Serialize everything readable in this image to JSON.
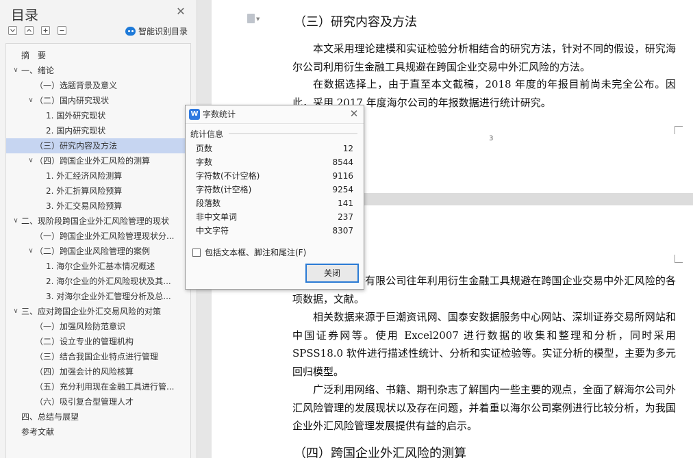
{
  "sidebar": {
    "title": "目录",
    "smart_toc_label": "智能识别目录",
    "toc": [
      {
        "label": "摘　要",
        "level": 0,
        "has_arrow": false,
        "active": false
      },
      {
        "label": "一、绪论",
        "level": 0,
        "has_arrow": true,
        "active": false
      },
      {
        "label": "（一）选题背景及意义",
        "level": 1,
        "has_arrow": false,
        "active": false
      },
      {
        "label": "（二）国内研究现状",
        "level": 1,
        "has_arrow": true,
        "active": false
      },
      {
        "label": "1. 国外研究现状",
        "level": 2,
        "has_arrow": false,
        "active": false
      },
      {
        "label": "2. 国内研究现状",
        "level": 2,
        "has_arrow": false,
        "active": false
      },
      {
        "label": "（三）研究内容及方法",
        "level": 1,
        "has_arrow": false,
        "active": true
      },
      {
        "label": "（四）跨国企业外汇风险的测算",
        "level": 1,
        "has_arrow": true,
        "active": false
      },
      {
        "label": "1. 外汇经济风险测算",
        "level": 2,
        "has_arrow": false,
        "active": false
      },
      {
        "label": "2. 外汇折算风险预算",
        "level": 2,
        "has_arrow": false,
        "active": false
      },
      {
        "label": "3. 外汇交易风险预算",
        "level": 2,
        "has_arrow": false,
        "active": false
      },
      {
        "label": "二、现阶段跨国企业外汇风险管理的现状",
        "level": 0,
        "has_arrow": true,
        "active": false
      },
      {
        "label": "（一）跨国企业外汇风险管理现状分...",
        "level": 1,
        "has_arrow": false,
        "active": false
      },
      {
        "label": "（二）跨国企业风险管理的案例",
        "level": 1,
        "has_arrow": true,
        "active": false
      },
      {
        "label": "1. 海尔企业外汇基本情况概述",
        "level": 2,
        "has_arrow": false,
        "active": false
      },
      {
        "label": "2. 海尔企业的外汇风险现状及其...",
        "level": 2,
        "has_arrow": false,
        "active": false
      },
      {
        "label": "3. 对海尔企业外汇管理分析及总...",
        "level": 2,
        "has_arrow": false,
        "active": false
      },
      {
        "label": "三、应对跨国企业外汇交易风险的对策",
        "level": 0,
        "has_arrow": true,
        "active": false
      },
      {
        "label": "（一）加强风险防范意识",
        "level": 1,
        "has_arrow": false,
        "active": false
      },
      {
        "label": "（二）设立专业的管理机构",
        "level": 1,
        "has_arrow": false,
        "active": false
      },
      {
        "label": "（三）结合我国企业特点进行管理",
        "level": 1,
        "has_arrow": false,
        "active": false
      },
      {
        "label": "（四）加强会计的风险核算",
        "level": 1,
        "has_arrow": false,
        "active": false
      },
      {
        "label": "（五）充分利用现在金融工具进行管...",
        "level": 1,
        "has_arrow": false,
        "active": false
      },
      {
        "label": "（六）吸引复合型管理人才",
        "level": 1,
        "has_arrow": false,
        "active": false
      },
      {
        "label": "四、总结与展望",
        "level": 0,
        "has_arrow": false,
        "active": false
      },
      {
        "label": "参考文献",
        "level": 0,
        "has_arrow": false,
        "active": false
      }
    ]
  },
  "document": {
    "page1": {
      "heading": "（三）研究内容及方法",
      "para1": "本文采用理论建模和实证检验分析相结合的研究方法，针对不同的假设，研究海尔公司利用衍生金融工具规避在跨国企业交易中外汇风险的方法。",
      "para2": "在数据选择上，由于直至本文截稿，2018 年度的年报目前尚未完全公布。因此，采用 2017 年度海尔公司的年报数据进行统计研究。",
      "page_number": "3"
    },
    "page2": {
      "para1": "为青岛海尔股份有限公司往年利用衍生金融工具规避在跨国企业交易中外汇风险的各项数据，文献。",
      "para2": "相关数据来源于巨潮资讯网、国泰安数据服务中心网站、深圳证券交易所网站和中国证券网等。使用 Excel2007 进行数据的收集和整理和分析，同时采用 SPSS18.0 软件进行描述性统计、分析和实证检验等。实证分析的模型，主要为多元回归模型。",
      "para3": "广泛利用网络、书籍、期刊杂志了解国内一些主要的观点，全面了解海尔公司外汇风险管理的发展现状以及存在问题，并着重以海尔公司案例进行比较分析，为我国企业外汇风险管理发展提供有益的启示。",
      "heading": "（四）跨国企业外汇风险的测算"
    }
  },
  "dialog": {
    "title": "字数统计",
    "section": "统计信息",
    "stats": [
      {
        "key": "页数",
        "value": "12"
      },
      {
        "key": "字数",
        "value": "8544"
      },
      {
        "key": "字符数(不计空格)",
        "value": "9116"
      },
      {
        "key": "字符数(计空格)",
        "value": "9254"
      },
      {
        "key": "段落数",
        "value": "141"
      },
      {
        "key": "非中文单词",
        "value": "237"
      },
      {
        "key": "中文字符",
        "value": "8307"
      }
    ],
    "checkbox_label": "包括文本框、脚注和尾注(F)",
    "checkbox_checked": false,
    "close_button": "关闭"
  }
}
